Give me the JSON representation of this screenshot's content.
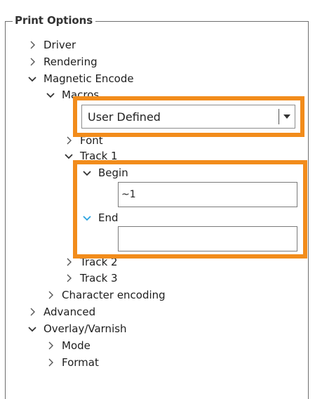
{
  "panel": {
    "title": "Print Options"
  },
  "tree": {
    "driver": "Driver",
    "rendering": "Rendering",
    "magnetic_encode": "Magnetic Encode",
    "macros": "Macros",
    "font": "Font",
    "track1": "Track 1",
    "begin": "Begin",
    "end": "End",
    "track2": "Track 2",
    "track3": "Track 3",
    "character_encoding": "Character encoding",
    "advanced": "Advanced",
    "overlay_varnish": "Overlay/Varnish",
    "mode": "Mode",
    "format": "Format"
  },
  "macros_select": {
    "value": "User Defined"
  },
  "begin_field": {
    "value": "~1"
  },
  "end_field": {
    "value": ""
  },
  "colors": {
    "highlight": "#f28c1b",
    "active_chevron": "#2aa3e0"
  }
}
